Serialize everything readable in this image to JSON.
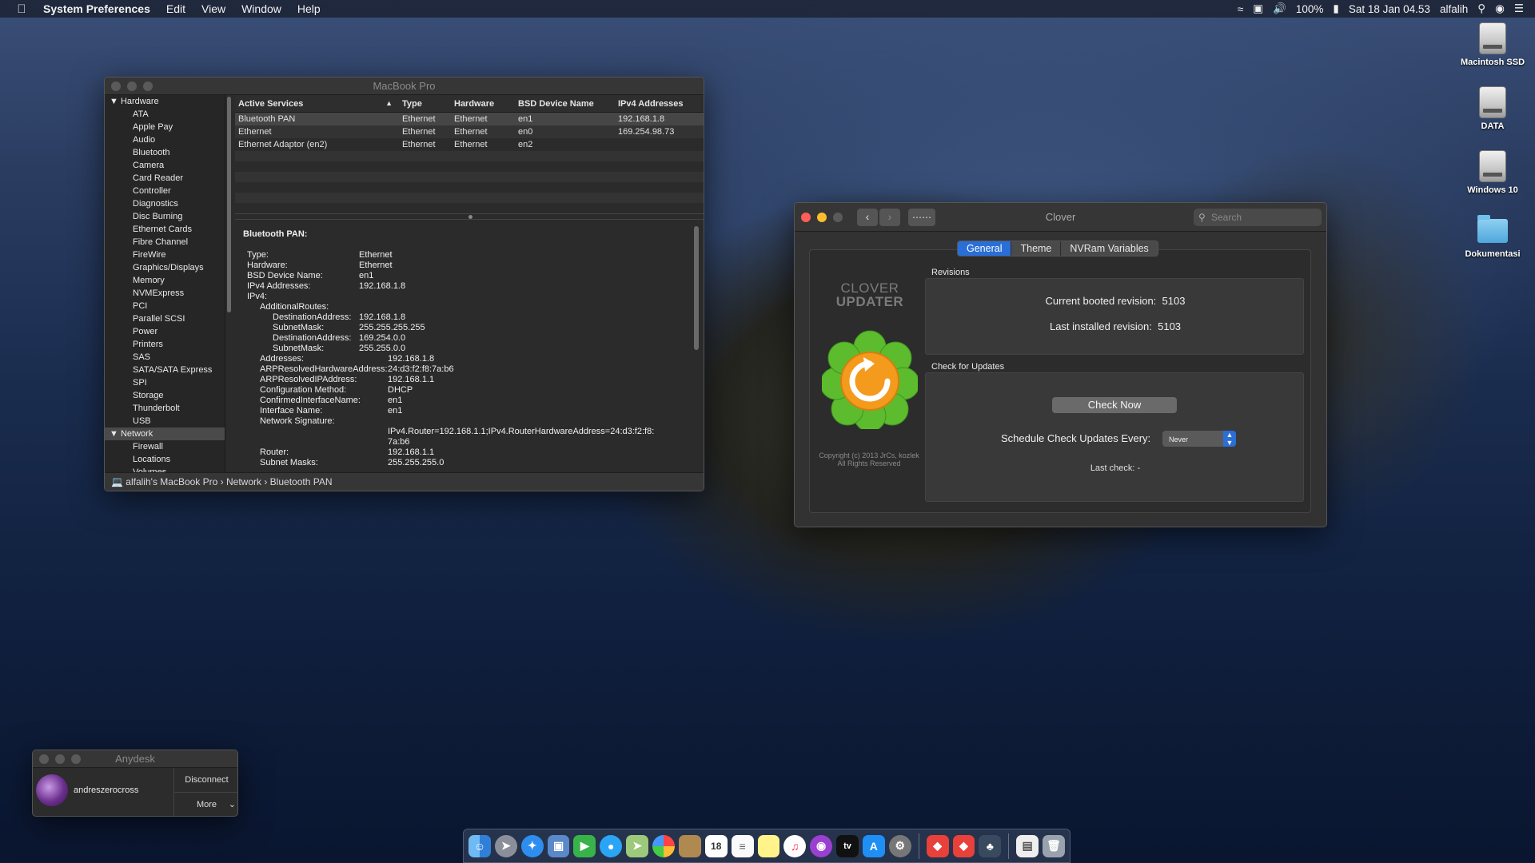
{
  "menubar": {
    "app": "System Preferences",
    "menus": [
      "Edit",
      "View",
      "Window",
      "Help"
    ],
    "battery": "100%",
    "datetime": "Sat 18 Jan  04.53",
    "user": "alfalih"
  },
  "desktop": {
    "icons": [
      "Macintosh SSD",
      "DATA",
      "Windows 10",
      "Dokumentasi"
    ]
  },
  "sysinfo": {
    "title": "MacBook Pro",
    "sidebar": {
      "hardware_label": "Hardware",
      "hardware_items": [
        "ATA",
        "Apple Pay",
        "Audio",
        "Bluetooth",
        "Camera",
        "Card Reader",
        "Controller",
        "Diagnostics",
        "Disc Burning",
        "Ethernet Cards",
        "Fibre Channel",
        "FireWire",
        "Graphics/Displays",
        "Memory",
        "NVMExpress",
        "PCI",
        "Parallel SCSI",
        "Power",
        "Printers",
        "SAS",
        "SATA/SATA Express",
        "SPI",
        "Storage",
        "Thunderbolt",
        "USB"
      ],
      "network_label": "Network",
      "network_items": [
        "Firewall",
        "Locations",
        "Volumes"
      ]
    },
    "table": {
      "headers": [
        "Active Services",
        "Type",
        "Hardware",
        "BSD Device Name",
        "IPv4 Addresses"
      ],
      "rows": [
        [
          "Bluetooth PAN",
          "Ethernet",
          "Ethernet",
          "en1",
          "192.168.1.8"
        ],
        [
          "Ethernet",
          "Ethernet",
          "Ethernet",
          "en0",
          "169.254.98.73"
        ],
        [
          "Ethernet Adaptor (en2)",
          "Ethernet",
          "Ethernet",
          "en2",
          ""
        ]
      ]
    },
    "detail": {
      "heading": "Bluetooth PAN:",
      "top": [
        [
          "Type:",
          "Ethernet"
        ],
        [
          "Hardware:",
          "Ethernet"
        ],
        [
          "BSD Device Name:",
          "en1"
        ],
        [
          "IPv4 Addresses:",
          "192.168.1.8"
        ],
        [
          "IPv4:",
          ""
        ]
      ],
      "routes_label": "AdditionalRoutes:",
      "routes": [
        [
          "DestinationAddress:",
          "192.168.1.8"
        ],
        [
          "SubnetMask:",
          "255.255.255.255"
        ],
        [
          "DestinationAddress:",
          "169.254.0.0"
        ],
        [
          "SubnetMask:",
          "255.255.0.0"
        ]
      ],
      "ipv4": [
        [
          "Addresses:",
          "192.168.1.8"
        ],
        [
          "ARPResolvedHardwareAddress:",
          "24:d3:f2:f8:7a:b6"
        ],
        [
          "ARPResolvedIPAddress:",
          "192.168.1.1"
        ],
        [
          "Configuration Method:",
          "DHCP"
        ],
        [
          "ConfirmedInterfaceName:",
          "en1"
        ],
        [
          "Interface Name:",
          "en1"
        ],
        [
          "Network Signature:",
          ""
        ]
      ],
      "signature_1": "IPv4.Router=192.168.1.1;IPv4.RouterHardwareAddress=24:d3:f2:f8:",
      "signature_2": "7a:b6",
      "tail": [
        [
          "Router:",
          "192.168.1.1"
        ],
        [
          "Subnet Masks:",
          "255.255.255.0"
        ]
      ]
    },
    "breadcrumb": [
      "alfalih's MacBook Pro",
      "Network",
      "Bluetooth PAN"
    ]
  },
  "clover": {
    "title": "Clover",
    "search_placeholder": "Search",
    "tabs": [
      "General",
      "Theme",
      "NVRam Variables"
    ],
    "logo_line1": "CLOVER",
    "logo_line2": "UPDATER",
    "copyright_1": "Copyright (c) 2013 JrCs, kozlek",
    "copyright_2": "All Rights Reserved",
    "revisions_label": "Revisions",
    "current_label": "Current booted revision:",
    "current_value": "5103",
    "installed_label": "Last installed revision:",
    "installed_value": "5103",
    "updates_label": "Check for Updates",
    "check_button": "Check Now",
    "schedule_label": "Schedule Check Updates Every:",
    "schedule_value": "Never",
    "last_check": "Last check: -"
  },
  "anydesk": {
    "title": "Anydesk",
    "user": "andreszerocross",
    "disconnect": "Disconnect",
    "more": "More"
  },
  "dock": {
    "items": [
      "finder-icon",
      "launchpad-icon",
      "safari-icon",
      "preview-icon",
      "facetime-icon",
      "messages-icon",
      "maps-icon",
      "photos-icon",
      "notes-paper-icon",
      "calendar-icon",
      "reminders-icon",
      "notes-icon",
      "music-icon",
      "podcasts-icon",
      "tv-icon",
      "appstore-icon",
      "system-preferences-icon",
      "anydesk-icon",
      "anydesk-alt-icon",
      "clover-icon",
      "document-icon",
      "trash-icon"
    ],
    "calendar_day": "18",
    "tv_label": "tv"
  }
}
